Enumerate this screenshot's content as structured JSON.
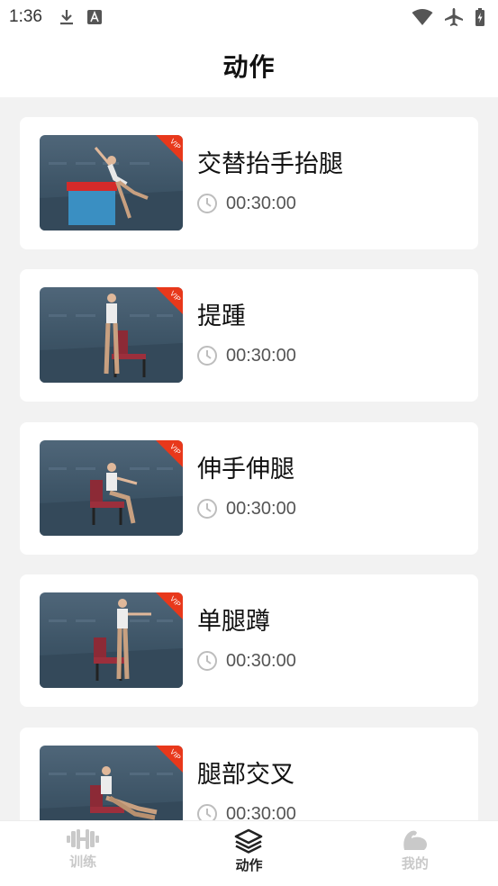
{
  "status_bar": {
    "time": "1:36",
    "left_icons": [
      "download-icon",
      "app-a-icon"
    ],
    "right_icons": [
      "wifi-icon",
      "airplane-icon",
      "battery-icon"
    ]
  },
  "header": {
    "title": "动作"
  },
  "exercises": [
    {
      "title": "交替抬手抬腿",
      "duration": "00:30:00",
      "badge": "VIP"
    },
    {
      "title": "提踵",
      "duration": "00:30:00",
      "badge": "VIP"
    },
    {
      "title": "伸手伸腿",
      "duration": "00:30:00",
      "badge": "VIP"
    },
    {
      "title": "单腿蹲",
      "duration": "00:30:00",
      "badge": "VIP"
    },
    {
      "title": "腿部交叉",
      "duration": "00:30:00",
      "badge": "VIP"
    }
  ],
  "bottom_nav": {
    "items": [
      {
        "label": "训练",
        "icon": "dumbbell-icon",
        "active": false
      },
      {
        "label": "动作",
        "icon": "layers-icon",
        "active": true
      },
      {
        "label": "我的",
        "icon": "arm-muscle-icon",
        "active": false
      }
    ]
  },
  "colors": {
    "vip_badge": "#e8381b",
    "thumb_bg": "#3f5669",
    "inactive_nav": "#c9c9c9",
    "active_nav": "#222222"
  }
}
